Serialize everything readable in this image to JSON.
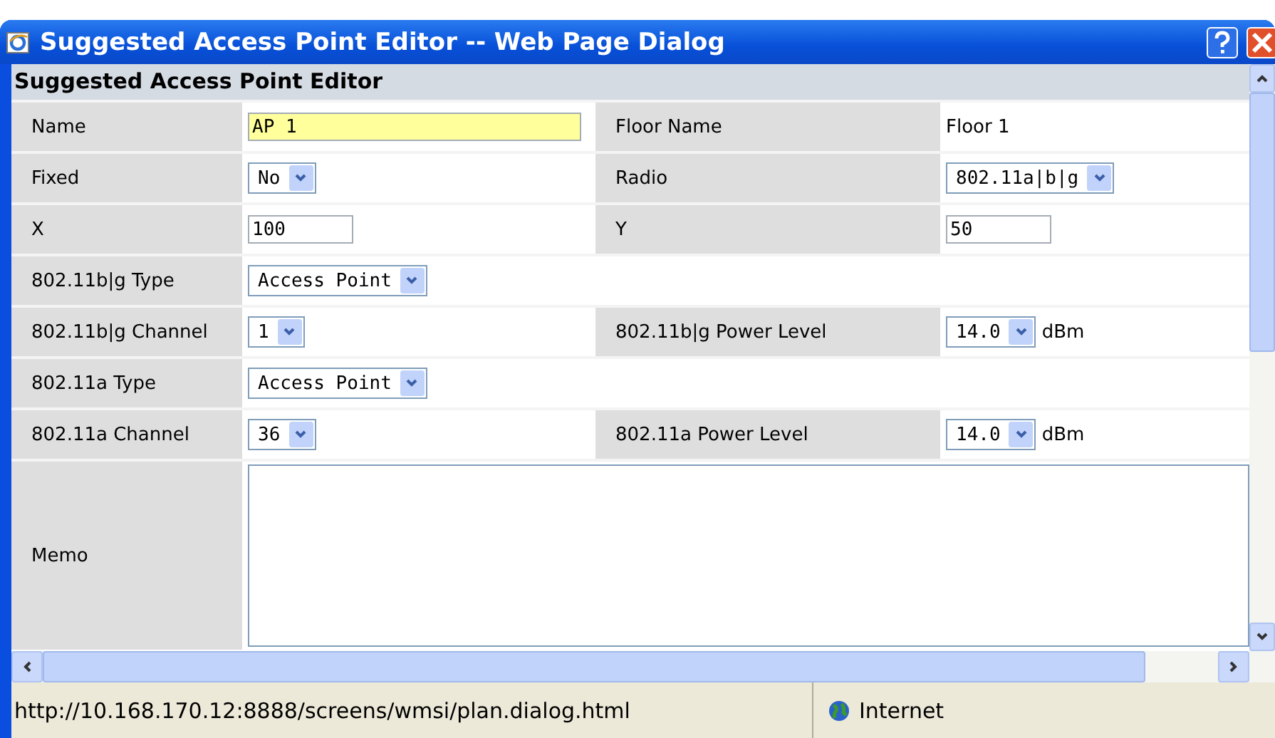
{
  "window": {
    "title": "Suggested Access Point Editor -- Web Page Dialog"
  },
  "form": {
    "heading": "Suggested Access Point Editor",
    "rows": [
      {
        "cells": [
          {
            "kind": "label",
            "text": "Name"
          },
          {
            "kind": "wide-input",
            "value": "AP 1",
            "focused": true
          },
          {
            "kind": "label",
            "text": "Floor Name"
          },
          {
            "kind": "text",
            "text": "Floor 1"
          }
        ]
      },
      {
        "cells": [
          {
            "kind": "label",
            "text": "Fixed"
          },
          {
            "kind": "select",
            "value": "No"
          },
          {
            "kind": "label",
            "text": "Radio"
          },
          {
            "kind": "select",
            "value": "802.11a|b|g"
          }
        ]
      },
      {
        "cells": [
          {
            "kind": "label",
            "text": "X"
          },
          {
            "kind": "input",
            "value": "100",
            "focused": false
          },
          {
            "kind": "label",
            "text": "Y"
          },
          {
            "kind": "input",
            "value": "50",
            "focused": false
          }
        ]
      },
      {
        "cells": [
          {
            "kind": "label",
            "text": "802.11b|g Type"
          },
          {
            "kind": "select",
            "value": "Access Point"
          }
        ]
      },
      {
        "cells": [
          {
            "kind": "label",
            "text": "802.11b|g Channel"
          },
          {
            "kind": "select",
            "value": "1"
          },
          {
            "kind": "label",
            "text": "802.11b|g Power Level"
          },
          {
            "kind": "select",
            "value": "14.0",
            "unit": "dBm"
          }
        ]
      },
      {
        "cells": [
          {
            "kind": "label",
            "text": "802.11a Type"
          },
          {
            "kind": "select",
            "value": "Access Point"
          }
        ]
      },
      {
        "cells": [
          {
            "kind": "label",
            "text": "802.11a Channel"
          },
          {
            "kind": "select",
            "value": "36"
          },
          {
            "kind": "label",
            "text": "802.11a Power Level"
          },
          {
            "kind": "select",
            "value": "14.0",
            "unit": "dBm"
          }
        ]
      },
      {
        "cells": [
          {
            "kind": "label",
            "text": "Memo"
          },
          {
            "kind": "textarea"
          }
        ]
      }
    ]
  },
  "status_bar": {
    "url": "http://10.168.170.12:8888/screens/wmsi/plan.dialog.html",
    "zone": "Internet"
  }
}
